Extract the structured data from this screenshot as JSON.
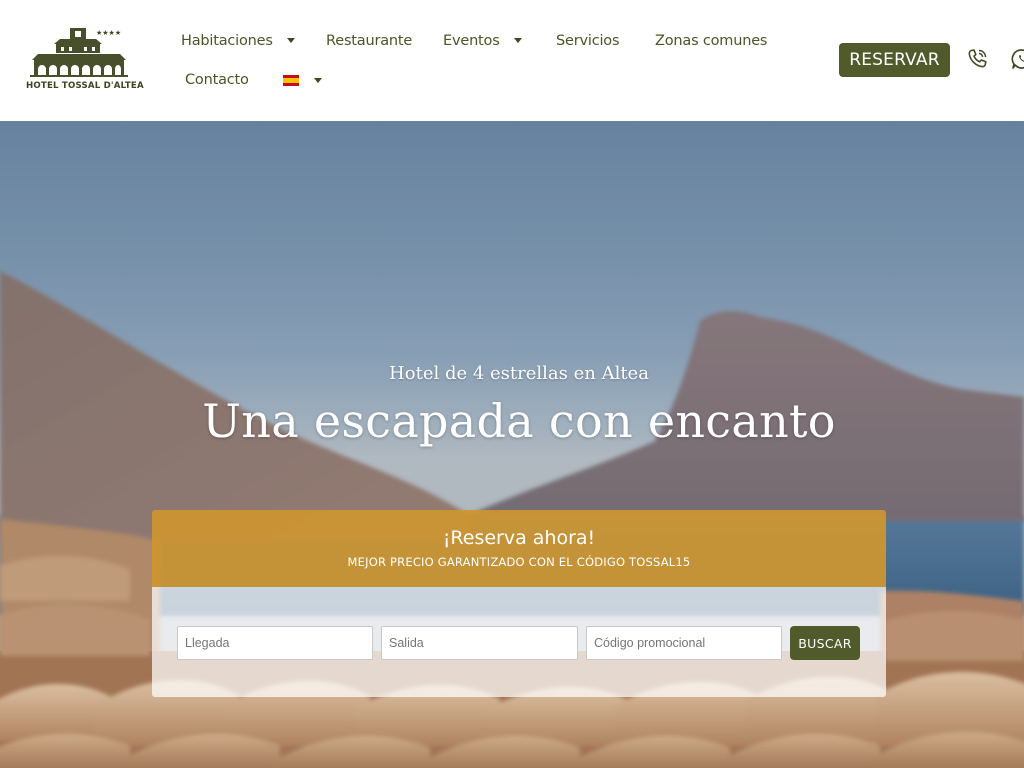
{
  "brand": {
    "name": "HOTEL TOSSAL D'ALTEA",
    "stars": "★★★★"
  },
  "nav": {
    "items": [
      {
        "label": "Habitaciones"
      },
      {
        "label": "Restaurante"
      },
      {
        "label": "Eventos"
      },
      {
        "label": "Servicios"
      },
      {
        "label": "Zonas comunes"
      },
      {
        "label": "Contacto"
      }
    ],
    "language": {
      "icon": "spain-flag-icon"
    }
  },
  "header": {
    "reserve_label": "RESERVAR",
    "phone_icon": "phone-icon",
    "whatsapp_icon": "whatsapp-icon"
  },
  "hero": {
    "subtitle": "Hotel de 4 estrellas en Altea",
    "title": "Una escapada con encanto"
  },
  "booking": {
    "title": "¡Reserva ahora!",
    "promo": "MEJOR PRECIO GARANTIZADO CON EL CÓDIGO TOSSAL15",
    "arrival_placeholder": "Llegada",
    "departure_placeholder": "Salida",
    "promo_code_placeholder": "Código promocional",
    "search_label": "BUSCAR"
  },
  "colors": {
    "brand_green": "#505a2b",
    "nav_text": "#4b5525",
    "booking_gold": "#cd9630"
  }
}
